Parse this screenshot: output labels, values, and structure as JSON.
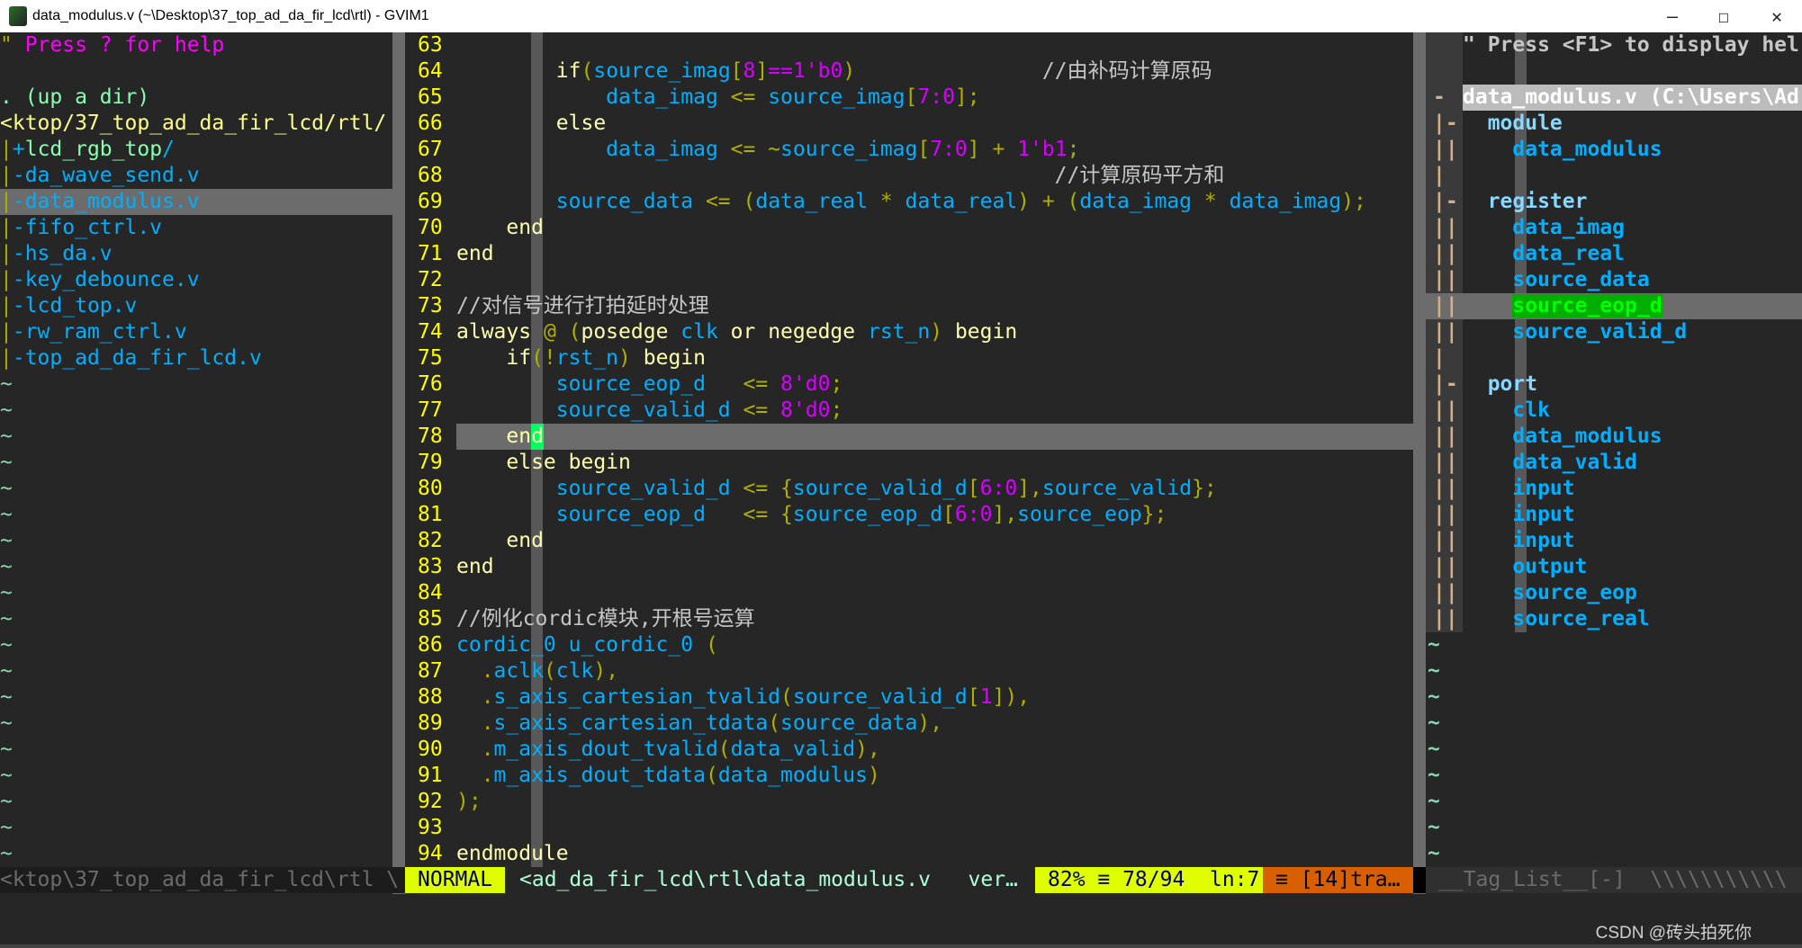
{
  "window": {
    "title": "data_modulus.v (~\\Desktop\\37_top_ad_da_fir_lcd\\rtl) - GVIM1",
    "minimize": "—",
    "maximize": "☐",
    "close": "✕"
  },
  "colors": {
    "background": "#262626",
    "keyword": "#ffffaf",
    "identifier": "#00afff",
    "number": "#d700ff",
    "operator": "#afaf00",
    "comment": "#c6c6c6",
    "line_number": "#ffff00",
    "mode_bg": "#dfff00",
    "position_bg": "#dfff00",
    "filetype_bg": "#d75f00"
  },
  "file_tree": {
    "rows": [
      [
        [
          "\" ",
          "o"
        ],
        [
          "Press ? for help",
          "n"
        ]
      ],
      [],
      [
        [
          ". (up a dir)",
          "g"
        ]
      ],
      [
        [
          "<ktop/37_top_ad_da_fir_lcd/rtl/",
          "y"
        ]
      ],
      [
        [
          "|",
          "b"
        ],
        [
          "+",
          "i"
        ],
        [
          "lcd_rgb_top",
          "g"
        ],
        [
          "/",
          "i"
        ]
      ],
      [
        [
          "|",
          "b"
        ],
        [
          "-da_wave_send.v",
          "i"
        ]
      ],
      [
        [
          "|",
          "b"
        ],
        [
          "-data_modulus.v",
          "i"
        ]
      ],
      [
        [
          "|",
          "b"
        ],
        [
          "-fifo_ctrl.v",
          "i"
        ]
      ],
      [
        [
          "|",
          "b"
        ],
        [
          "-hs_da.v",
          "i"
        ]
      ],
      [
        [
          "|",
          "b"
        ],
        [
          "-key_debounce.v",
          "i"
        ]
      ],
      [
        [
          "|",
          "b"
        ],
        [
          "-lcd_top.v",
          "i"
        ]
      ],
      [
        [
          "|",
          "b"
        ],
        [
          "-rw_ram_ctrl.v",
          "i"
        ]
      ],
      [
        [
          "|",
          "b"
        ],
        [
          "-top_ad_da_fir_lcd.v",
          "i"
        ]
      ]
    ],
    "selected_row": 6,
    "empty_marker": "~",
    "status": "<ktop\\37_top_ad_da_fir_lcd\\rtl \\"
  },
  "editor": {
    "cursor_line": 78,
    "lines": [
      {
        "num": "63",
        "t": []
      },
      {
        "num": "64",
        "t": [
          [
            "        ",
            "p"
          ],
          [
            "if",
            "k"
          ],
          [
            "(",
            "o"
          ],
          [
            "source_imag",
            "i"
          ],
          [
            "[",
            "o"
          ],
          [
            "8",
            "n"
          ],
          [
            "]",
            "o"
          ],
          [
            "==1'b0",
            "n"
          ],
          [
            ")",
            "o"
          ],
          [
            "               ",
            "p"
          ],
          [
            "//由补码计算原码",
            "c"
          ]
        ]
      },
      {
        "num": "65",
        "t": [
          [
            "            ",
            "p"
          ],
          [
            "data_imag",
            "i"
          ],
          [
            " <= ",
            "o"
          ],
          [
            "source_imag",
            "i"
          ],
          [
            "[",
            "o"
          ],
          [
            "7:0",
            "n"
          ],
          [
            "];",
            "o"
          ]
        ]
      },
      {
        "num": "66",
        "t": [
          [
            "        ",
            "p"
          ],
          [
            "else",
            "k"
          ]
        ]
      },
      {
        "num": "67",
        "t": [
          [
            "            ",
            "p"
          ],
          [
            "data_imag",
            "i"
          ],
          [
            " <= ~",
            "o"
          ],
          [
            "source_imag",
            "i"
          ],
          [
            "[",
            "o"
          ],
          [
            "7:0",
            "n"
          ],
          [
            "] + ",
            "o"
          ],
          [
            "1'b1",
            "n"
          ],
          [
            ";",
            "o"
          ]
        ]
      },
      {
        "num": "68",
        "t": [
          [
            "                                                ",
            "p"
          ],
          [
            "//计算原码平方和",
            "c"
          ]
        ]
      },
      {
        "num": "69",
        "t": [
          [
            "        ",
            "p"
          ],
          [
            "source_data",
            "i"
          ],
          [
            " <= (",
            "o"
          ],
          [
            "data_real",
            "i"
          ],
          [
            " * ",
            "o"
          ],
          [
            "data_real",
            "i"
          ],
          [
            ") + (",
            "o"
          ],
          [
            "data_imag",
            "i"
          ],
          [
            " * ",
            "o"
          ],
          [
            "data_imag",
            "i"
          ],
          [
            ");",
            "o"
          ]
        ]
      },
      {
        "num": "70",
        "t": [
          [
            "    ",
            "p"
          ],
          [
            "end",
            "k"
          ]
        ]
      },
      {
        "num": "71",
        "t": [
          [
            "end",
            "k"
          ]
        ]
      },
      {
        "num": "72",
        "t": []
      },
      {
        "num": "73",
        "t": [
          [
            "//对信号进行打拍延时处理",
            "c"
          ]
        ]
      },
      {
        "num": "74",
        "t": [
          [
            "always",
            "k"
          ],
          [
            " @ (",
            "o"
          ],
          [
            "posedge ",
            "p"
          ],
          [
            "clk",
            "i"
          ],
          [
            " or negedge ",
            "p"
          ],
          [
            "rst_n",
            "i"
          ],
          [
            ") ",
            "o"
          ],
          [
            "begin",
            "k"
          ]
        ]
      },
      {
        "num": "75",
        "t": [
          [
            "    ",
            "p"
          ],
          [
            "if",
            "k"
          ],
          [
            "(!",
            "o"
          ],
          [
            "rst_n",
            "i"
          ],
          [
            ") ",
            "o"
          ],
          [
            "begin",
            "k"
          ]
        ]
      },
      {
        "num": "76",
        "t": [
          [
            "        ",
            "p"
          ],
          [
            "source_eop_d",
            "i"
          ],
          [
            "   <= ",
            "o"
          ],
          [
            "8'd0",
            "n"
          ],
          [
            ";",
            "o"
          ]
        ]
      },
      {
        "num": "77",
        "t": [
          [
            "        ",
            "p"
          ],
          [
            "source_valid_d",
            "i"
          ],
          [
            " <= ",
            "o"
          ],
          [
            "8'd0",
            "n"
          ],
          [
            ";",
            "o"
          ]
        ]
      },
      {
        "num": "78",
        "t": [
          [
            "    ",
            "p"
          ],
          [
            "end",
            "k"
          ]
        ]
      },
      {
        "num": "79",
        "t": [
          [
            "    ",
            "p"
          ],
          [
            "else begin",
            "k"
          ]
        ]
      },
      {
        "num": "80",
        "t": [
          [
            "        ",
            "p"
          ],
          [
            "source_valid_d",
            "i"
          ],
          [
            " <= {",
            "o"
          ],
          [
            "source_valid_d",
            "i"
          ],
          [
            "[",
            "o"
          ],
          [
            "6:0",
            "n"
          ],
          [
            "],",
            "o"
          ],
          [
            "source_valid",
            "i"
          ],
          [
            "};",
            "o"
          ]
        ]
      },
      {
        "num": "81",
        "t": [
          [
            "        ",
            "p"
          ],
          [
            "source_eop_d",
            "i"
          ],
          [
            "   <= {",
            "o"
          ],
          [
            "source_eop_d",
            "i"
          ],
          [
            "[",
            "o"
          ],
          [
            "6:0",
            "n"
          ],
          [
            "],",
            "o"
          ],
          [
            "source_eop",
            "i"
          ],
          [
            "};",
            "o"
          ]
        ]
      },
      {
        "num": "82",
        "t": [
          [
            "    ",
            "p"
          ],
          [
            "end",
            "k"
          ]
        ]
      },
      {
        "num": "83",
        "t": [
          [
            "end",
            "k"
          ]
        ]
      },
      {
        "num": "84",
        "t": []
      },
      {
        "num": "85",
        "t": [
          [
            "//例化cordic模块,开根号运算",
            "c"
          ]
        ]
      },
      {
        "num": "86",
        "t": [
          [
            "cordic_0 u_cordic_0",
            "i"
          ],
          [
            " (",
            "o"
          ]
        ]
      },
      {
        "num": "87",
        "t": [
          [
            "  .",
            "o"
          ],
          [
            "aclk",
            "i"
          ],
          [
            "(",
            "o"
          ],
          [
            "clk",
            "i"
          ],
          [
            "),",
            "o"
          ]
        ]
      },
      {
        "num": "88",
        "t": [
          [
            "  .",
            "o"
          ],
          [
            "s_axis_cartesian_tvalid",
            "i"
          ],
          [
            "(",
            "o"
          ],
          [
            "source_valid_d",
            "i"
          ],
          [
            "[",
            "o"
          ],
          [
            "1",
            "n"
          ],
          [
            "]),",
            "o"
          ]
        ]
      },
      {
        "num": "89",
        "t": [
          [
            "  .",
            "o"
          ],
          [
            "s_axis_cartesian_tdata",
            "i"
          ],
          [
            "(",
            "o"
          ],
          [
            "source_data",
            "i"
          ],
          [
            "),",
            "o"
          ]
        ]
      },
      {
        "num": "90",
        "t": [
          [
            "  .",
            "o"
          ],
          [
            "m_axis_dout_tvalid",
            "i"
          ],
          [
            "(",
            "o"
          ],
          [
            "data_valid",
            "i"
          ],
          [
            "),",
            "o"
          ]
        ]
      },
      {
        "num": "91",
        "t": [
          [
            "  .",
            "o"
          ],
          [
            "m_axis_dout_tdata",
            "i"
          ],
          [
            "(",
            "o"
          ],
          [
            "data_modulus",
            "i"
          ],
          [
            ")",
            "o"
          ]
        ]
      },
      {
        "num": "92",
        "t": [
          [
            ");",
            "o"
          ]
        ]
      },
      {
        "num": "93",
        "t": []
      },
      {
        "num": "94",
        "t": [
          [
            "endmodule",
            "k"
          ]
        ]
      }
    ]
  },
  "statusline": {
    "mode": "NORMAL",
    "file": "<ad_da_fir_lcd\\rtl\\data_modulus.v",
    "filetype": "ver…",
    "position": "82% ≡ 78/94  ln:7",
    "extra": "≡ [14]tra…"
  },
  "tagbar": {
    "rows": [
      {
        "fold": "",
        "t": "\" Press <F1> to display hel",
        "c": "h"
      },
      {
        "fold": "",
        "t": "",
        "c": "h"
      },
      {
        "fold": "-",
        "t": "data_modulus.v (C:\\Users\\Ad",
        "c": "f"
      },
      {
        "fold": "|-",
        "t": "  module",
        "c": "s"
      },
      {
        "fold": "||",
        "t": "    data_modulus",
        "c": "i"
      },
      {
        "fold": "|",
        "t": "",
        "c": "i"
      },
      {
        "fold": "|-",
        "t": "  register",
        "c": "s"
      },
      {
        "fold": "||",
        "t": "    data_imag",
        "c": "i"
      },
      {
        "fold": "||",
        "t": "    data_real",
        "c": "i"
      },
      {
        "fold": "||",
        "t": "    source_data",
        "c": "i"
      },
      {
        "fold": "||",
        "t": "    source_eop_d",
        "c": "sel"
      },
      {
        "fold": "||",
        "t": "    source_valid_d",
        "c": "i"
      },
      {
        "fold": "|",
        "t": "",
        "c": "i"
      },
      {
        "fold": "|-",
        "t": "  port",
        "c": "s"
      },
      {
        "fold": "||",
        "t": "    clk",
        "c": "i"
      },
      {
        "fold": "||",
        "t": "    data_modulus",
        "c": "i"
      },
      {
        "fold": "||",
        "t": "    data_valid",
        "c": "i"
      },
      {
        "fold": "||",
        "t": "    input",
        "c": "i"
      },
      {
        "fold": "||",
        "t": "    input",
        "c": "i"
      },
      {
        "fold": "||",
        "t": "    input",
        "c": "i"
      },
      {
        "fold": "||",
        "t": "    output",
        "c": "i"
      },
      {
        "fold": "||",
        "t": "    source_eop",
        "c": "i"
      },
      {
        "fold": "||",
        "t": "    source_real",
        "c": "i"
      }
    ],
    "status": "__Tag_List__[-]  \\\\\\\\\\\\\\\\\\\\\\"
  },
  "watermark": "CSDN @砖头拍死你"
}
